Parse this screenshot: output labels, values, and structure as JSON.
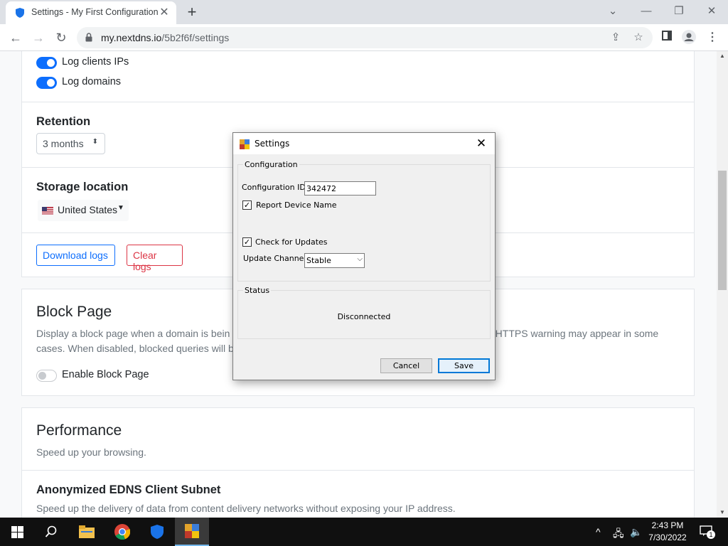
{
  "browser": {
    "tab_title": "Settings - My First Configuration",
    "url_host": "my.nextdns.io",
    "url_path": "/5b2f6f/settings"
  },
  "logs": {
    "log_client_ips": {
      "label": "Log clients IPs",
      "on": true
    },
    "log_domains": {
      "label": "Log domains",
      "on": true
    },
    "retention_title": "Retention",
    "retention_value": "3 months",
    "storage_title": "Storage location",
    "storage_value": "United States",
    "download_button": "Download logs",
    "clear_button": "Clear logs"
  },
  "block_page": {
    "title": "Block Page",
    "desc_line1_left": "Display a block page when a domain is bein",
    "desc_line1_right": "n HTTPS warning may appear in some",
    "desc_line2_left": "cases. When disabled, blocked queries will b",
    "toggle_label": "Enable Block Page",
    "toggle_on": false
  },
  "performance": {
    "title": "Performance",
    "subtitle": "Speed up your browsing.",
    "ecs_title": "Anonymized EDNS Client Subnet",
    "ecs_desc": "Speed up the delivery of data from content delivery networks without exposing your IP address."
  },
  "dialog": {
    "title": "Settings",
    "config_group": "Configuration",
    "config_id_label": "Configuration ID:",
    "config_id_value": "342472",
    "report_device_label": "Report Device Name",
    "report_device_checked": true,
    "check_updates_label": "Check for Updates",
    "check_updates_checked": true,
    "update_channel_label": "Update Channel:",
    "update_channel_value": "Stable",
    "status_group": "Status",
    "status_text": "Disconnected",
    "cancel_button": "Cancel",
    "save_button": "Save"
  },
  "taskbar": {
    "time": "2:43 PM",
    "date": "7/30/2022",
    "notification_count": "1"
  },
  "colors": {
    "primary": "#0d6efd",
    "danger": "#dc3545",
    "taskbar": "#101010"
  }
}
